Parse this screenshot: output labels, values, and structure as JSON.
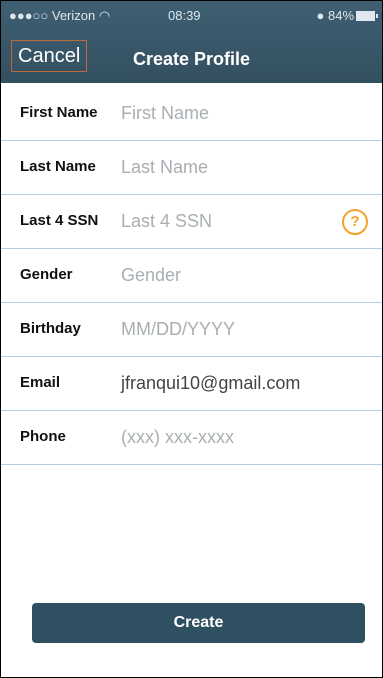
{
  "status_bar": {
    "carrier": "●●●○○ Verizon ◠",
    "time": "08:39",
    "battery": "● 84%"
  },
  "nav": {
    "cancel_label": "Cancel",
    "title": "Create Profile"
  },
  "form": {
    "fields": [
      {
        "label": "First Name",
        "placeholder": "First Name",
        "value": ""
      },
      {
        "label": "Last Name",
        "placeholder": "Last Name",
        "value": ""
      },
      {
        "label": "Last 4 SSN",
        "placeholder": "Last 4 SSN",
        "value": "",
        "help_icon": "?"
      },
      {
        "label": "Gender",
        "placeholder": "Gender",
        "value": ""
      },
      {
        "label": "Birthday",
        "placeholder": "MM/DD/YYYY",
        "value": ""
      },
      {
        "label": "Email",
        "placeholder": "",
        "value": "jfranqui10@gmail.com"
      },
      {
        "label": "Phone",
        "placeholder": "(xxx) xxx-xxxx",
        "value": ""
      }
    ]
  },
  "create_label": "Create",
  "colors": {
    "header": "#3b5a6d",
    "accent": "#f2a32b",
    "divider": "#b7cde2",
    "button": "#2f5060"
  }
}
